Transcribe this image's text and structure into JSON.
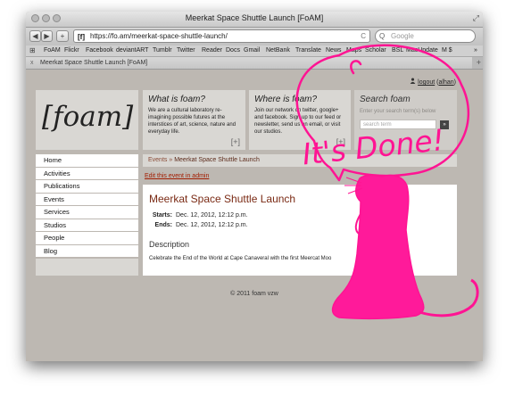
{
  "browser": {
    "window_title": "Meerkat Space Shuttle Launch [FoAM]",
    "url": "https://fo.am/meerkat-space-shuttle-launch/",
    "url_icon": "[f]",
    "search_placeholder": "Google",
    "back_glyph": "◀",
    "forward_glyph": "▶",
    "new_tab_glyph": "+",
    "reload_glyph": "C",
    "search_glyph": "Q",
    "bookmarks_glyph": "⊞",
    "resize_glyph": "⤢",
    "bookmarks": [
      "FoAM",
      "Flickr",
      "Facebook",
      "deviantART",
      "Tumblr",
      "Twitter",
      "Reader",
      "Docs",
      "Gmail",
      "NetBank",
      "Translate",
      "News",
      "Maps",
      "Scholar",
      "BSL",
      "MacUpdate",
      "M $",
      "»"
    ],
    "tab_title": "Meerkat Space Shuttle Launch [FoAM]",
    "tab_close": "x",
    "tab_add": "+"
  },
  "header": {
    "user_icon": "person-icon",
    "logout_label": "logout",
    "username": "alhan",
    "logo": "[foam]"
  },
  "panels": [
    {
      "title": "What is foam?",
      "body": "We are a cultural laboratory re-imagining possible futures at the interstices of art, science, nature and everyday life.",
      "more": "[+]"
    },
    {
      "title": "Where is foam?",
      "body": "Join our network on twitter, google+ and facebook. Sign up to our feed or newsletter, send us an email, or visit our studios.",
      "more": "[+]"
    }
  ],
  "search": {
    "title": "Search foam",
    "hint": "Enter your search term(s) below",
    "placeholder": "search term",
    "button": "»"
  },
  "nav": [
    "Home",
    "Activities",
    "Publications",
    "Events",
    "Services",
    "Studios",
    "People",
    "Blog"
  ],
  "breadcrumb": {
    "parent": "Events",
    "sep": " » ",
    "current": "Meerkat Space Shuttle Launch"
  },
  "edit_link": "Edit this event in admin",
  "event": {
    "title": "Meerkat Space Shuttle Launch",
    "starts_label": "Starts:",
    "starts": "Dec. 12, 2012, 12:12 p.m.",
    "ends_label": "Ends:",
    "ends": "Dec. 12, 2012, 12:12 p.m.",
    "description_heading": "Description",
    "description": "Celebrate the End of the World at Cape Canaveral with the first Meercat Moo"
  },
  "footer": "© 2011 foam vzw",
  "annotation": {
    "text": "It's Done!",
    "color": "#ff1493"
  }
}
